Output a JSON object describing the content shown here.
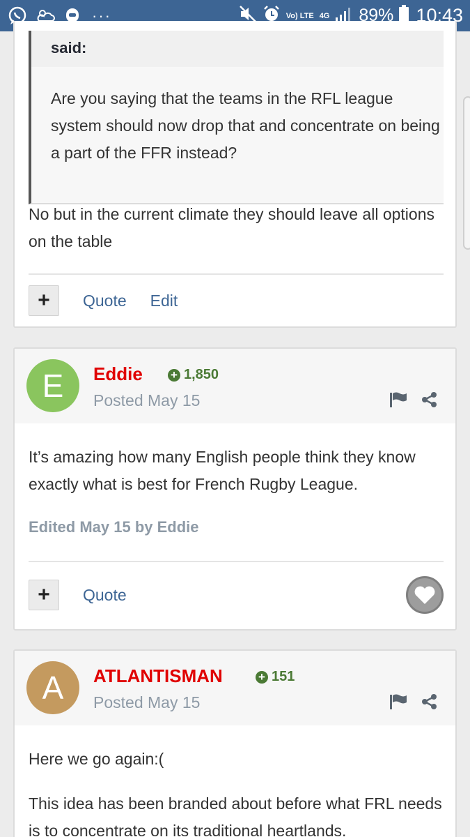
{
  "status_bar": {
    "network_small": "Vo) LTE",
    "network_gen": "4G",
    "battery": "89%",
    "time": "10:43",
    "colors": {
      "background": "#3d6594"
    }
  },
  "posts": [
    {
      "quote": {
        "header": "said:",
        "text": "Are you saying that the teams in the RFL league system should now drop that and  concentrate on being a part of the FFR instead?"
      },
      "body": "No but in the current climate they should leave all options on the table",
      "actions": {
        "quote_label": "Quote",
        "edit_label": "Edit"
      }
    },
    {
      "author": {
        "initial": "E",
        "name": "Eddie",
        "reputation": "1,850",
        "avatar_color": "#8ac55e"
      },
      "posted": "Posted May 15",
      "body": "It’s amazing how many English people think they know exactly what is best for French Rugby League.",
      "edited": "Edited May 15 by Eddie",
      "actions": {
        "quote_label": "Quote"
      }
    },
    {
      "author": {
        "initial": "A",
        "name": "ATLANTISMAN",
        "reputation": "151",
        "avatar_color": "#c49a5f"
      },
      "posted": "Posted May 15",
      "body": [
        "Here we go again:(",
        "This idea has been branded about before what FRL needs is to concentrate on its traditional heartlands."
      ]
    }
  ],
  "icons": [
    "whatsapp-icon",
    "cloud-icon",
    "emoji-icon",
    "mute-icon",
    "alarm-icon",
    "signal-icon",
    "battery-icon",
    "plus-icon",
    "flag-icon",
    "share-icon",
    "heart-icon"
  ],
  "colors": {
    "author_name": "#e00000",
    "reputation": "#4b7a35",
    "link": "#3d6594"
  }
}
